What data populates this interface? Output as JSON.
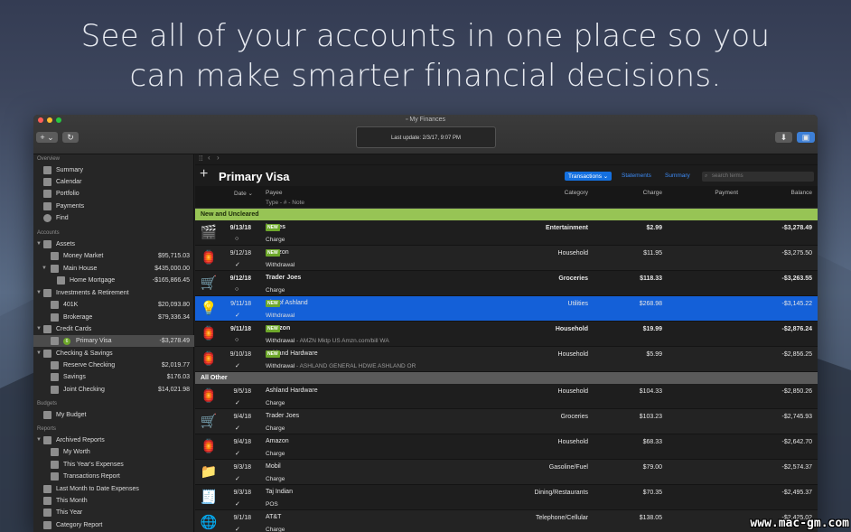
{
  "hero": {
    "line1": "See all of your accounts in one place so you",
    "line2": "can make smarter financial decisions."
  },
  "window": {
    "title": "My Finances",
    "last_update": "Last update: 2/3/17, 9:07 PM",
    "add_btn": "+ ⌄",
    "refresh_btn": "↻"
  },
  "sidebar": {
    "overview_label": "Overview",
    "overview": [
      "Summary",
      "Calendar",
      "Portfolio",
      "Payments",
      "Find"
    ],
    "accounts_label": "Accounts",
    "assets": {
      "label": "Assets",
      "items": [
        {
          "name": "Money Market",
          "amount": "$95,715.03"
        },
        {
          "name": "Main House",
          "amount": "$435,000.00"
        },
        {
          "name": "Home Mortgage",
          "amount": "-$165,866.45"
        }
      ]
    },
    "investments": {
      "label": "Investments & Retirement",
      "items": [
        {
          "name": "401K",
          "amount": "$20,093.80"
        },
        {
          "name": "Brokerage",
          "amount": "$79,336.34"
        }
      ]
    },
    "credit": {
      "label": "Credit Cards",
      "items": [
        {
          "name": "Primary Visa",
          "amount": "-$3,278.49",
          "badge": "6"
        }
      ]
    },
    "checking": {
      "label": "Checking & Savings",
      "items": [
        {
          "name": "Reserve Checking",
          "amount": "$2,019.77"
        },
        {
          "name": "Savings",
          "amount": "$176.03"
        },
        {
          "name": "Joint Checking",
          "amount": "$14,021.98"
        }
      ]
    },
    "budgets_label": "Budgets",
    "budgets": [
      "My Budget"
    ],
    "reports_label": "Reports",
    "archived": {
      "label": "Archived Reports",
      "items": [
        "My Worth",
        "This Year's Expenses",
        "Transactions Report"
      ]
    },
    "reports": [
      "Last Month to Date Expenses",
      "This Month",
      "This Year",
      "Category Report"
    ]
  },
  "main": {
    "account_title": "Primary Visa",
    "tabs": [
      "Transactions ⌄",
      "Statements",
      "Summary"
    ],
    "search_placeholder": "search terms",
    "columns": {
      "date": "Date ⌄",
      "payee": "Payee",
      "sub": "Type  -  #  -  Note",
      "category": "Category",
      "charge": "Charge",
      "payment": "Payment",
      "balance": "Balance"
    },
    "group_new": "New and Uncleared",
    "group_other": "All Other",
    "new_label": "NEW",
    "new_rows": [
      {
        "icon": "🎬",
        "date": "9/13/18",
        "status": "○",
        "new": true,
        "payee": "iTunes",
        "type": "Charge",
        "memo": "",
        "category": "Entertainment",
        "charge": "$2.99",
        "balance": "-$3,278.49",
        "bold": true
      },
      {
        "icon": "🏮",
        "date": "9/12/18",
        "status": "✓",
        "new": true,
        "payee": "Amazon",
        "type": "Withdrawal",
        "memo": "",
        "category": "Household",
        "charge": "$11.95",
        "balance": "-$3,275.50",
        "bold": false
      },
      {
        "icon": "🛒",
        "date": "9/12/18",
        "status": "○",
        "new": false,
        "payee": "Trader Joes",
        "type": "Charge",
        "memo": "",
        "category": "Groceries",
        "charge": "$118.33",
        "balance": "-$3,263.55",
        "bold": true
      },
      {
        "icon": "💡",
        "date": "9/11/18",
        "status": "✓",
        "new": true,
        "payee": "City of Ashland",
        "type": "Withdrawal",
        "memo": "",
        "category": "Utilities",
        "charge": "$268.98",
        "balance": "-$3,145.22",
        "bold": false,
        "selected": true
      },
      {
        "icon": "🏮",
        "date": "9/11/18",
        "status": "○",
        "new": true,
        "payee": "Amazon",
        "type": "Withdrawal",
        "memo": " - AMZN Mktp US Amzn.com/bill WA",
        "category": "Household",
        "charge": "$19.99",
        "balance": "-$2,876.24",
        "bold": true
      },
      {
        "icon": "🏮",
        "date": "9/10/18",
        "status": "✓",
        "new": true,
        "payee": "Ashland Hardware",
        "type": "Withdrawal",
        "memo": " - ASHLAND GENERAL HDWE ASHLAND OR",
        "category": "Household",
        "charge": "$5.99",
        "balance": "-$2,856.25",
        "bold": false
      }
    ],
    "other_rows": [
      {
        "icon": "🏮",
        "date": "9/5/18",
        "status": "✓",
        "payee": "Ashland Hardware",
        "type": "Charge",
        "category": "Household",
        "charge": "$104.33",
        "balance": "-$2,850.26"
      },
      {
        "icon": "🛒",
        "date": "9/4/18",
        "status": "✓",
        "payee": "Trader Joes",
        "type": "Charge",
        "category": "Groceries",
        "charge": "$103.23",
        "balance": "-$2,745.93"
      },
      {
        "icon": "🏮",
        "date": "9/4/18",
        "status": "✓",
        "payee": "Amazon",
        "type": "Charge",
        "category": "Household",
        "charge": "$68.33",
        "balance": "-$2,642.70"
      },
      {
        "icon": "📁",
        "date": "9/3/18",
        "status": "✓",
        "payee": "Mobil",
        "type": "Charge",
        "category": "Gasoline/Fuel",
        "charge": "$79.00",
        "balance": "-$2,574.37"
      },
      {
        "icon": "🧾",
        "date": "9/3/18",
        "status": "✓",
        "payee": "Taj Indian",
        "type": "POS",
        "category": "Dining/Restaurants",
        "charge": "$70.35",
        "balance": "-$2,495.37"
      },
      {
        "icon": "🌐",
        "date": "9/1/18",
        "status": "✓",
        "payee": "AT&T",
        "type": "Charge",
        "category": "Telephone/Cellular",
        "charge": "$138.05",
        "balance": "-$2,425.02"
      }
    ]
  },
  "watermark": "www.mac-gm.com",
  "colors": {
    "accent": "#1470e0",
    "new_group": "#97c455",
    "other_group": "#5a5a5a",
    "new_badge": "#6ea82b"
  }
}
